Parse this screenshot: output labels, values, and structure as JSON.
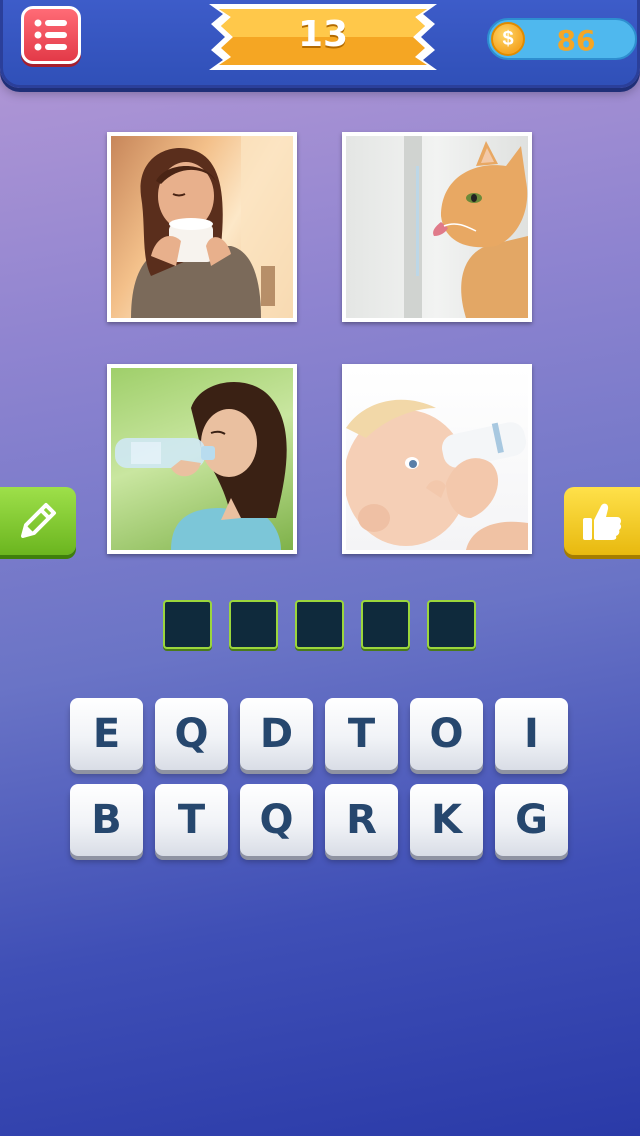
{
  "header": {
    "menu_icon": "list-menu-icon",
    "level": "13",
    "coins": "86",
    "coin_icon": "dollar-coin-icon",
    "coin_symbol": "$"
  },
  "pictures": [
    {
      "subject": "woman drinking from cup"
    },
    {
      "subject": "cat drinking from tap"
    },
    {
      "subject": "woman drinking from bottle"
    },
    {
      "subject": "baby drinking from bottle"
    }
  ],
  "side_buttons": {
    "left_icon": "pencil-icon",
    "right_icon": "thumbs-up-icon"
  },
  "answer": {
    "slot_count": 5,
    "letters": [
      "",
      "",
      "",
      "",
      ""
    ]
  },
  "keyboard": {
    "rows": [
      [
        "E",
        "Q",
        "D",
        "T",
        "O",
        "I"
      ],
      [
        "B",
        "T",
        "Q",
        "R",
        "K",
        "G"
      ]
    ]
  },
  "colors": {
    "menu_button": "#e33a48",
    "level_banner": "#f5a623",
    "coin_bar": "#4fb8ee",
    "pencil_button": "#6bb51f",
    "thumb_button": "#e8b90f",
    "slot": "#0f2a3c",
    "key_text": "#26476e"
  }
}
